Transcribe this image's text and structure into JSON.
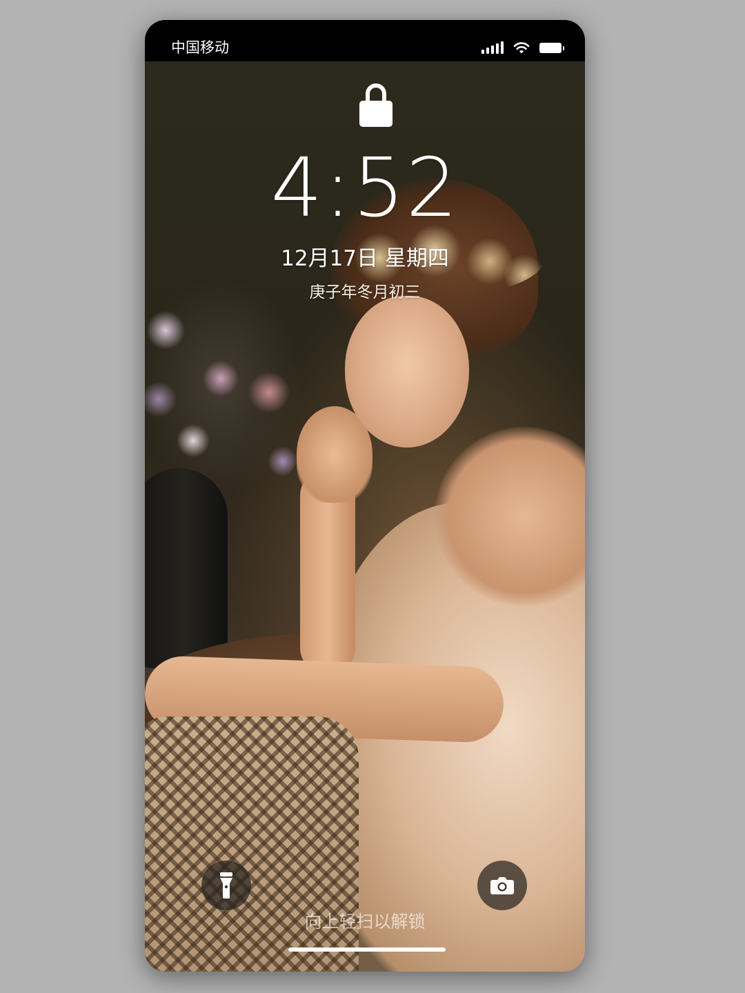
{
  "status_bar": {
    "carrier": "中国移动",
    "signal_icon": "signal-bars-icon",
    "wifi_icon": "wifi-icon",
    "battery_icon": "battery-icon"
  },
  "lock_screen": {
    "lock_icon": "padlock-icon",
    "time": "4:52",
    "date": "12月17日 星期四",
    "lunar_date": "庚子年冬月初三",
    "flashlight_icon": "flashlight-icon",
    "camera_icon": "camera-icon",
    "swipe_hint": "向上轻扫以解锁"
  },
  "colors": {
    "backdrop": "#b3b3b3",
    "status_bar_bg": "#000000",
    "text": "#ffffff"
  }
}
